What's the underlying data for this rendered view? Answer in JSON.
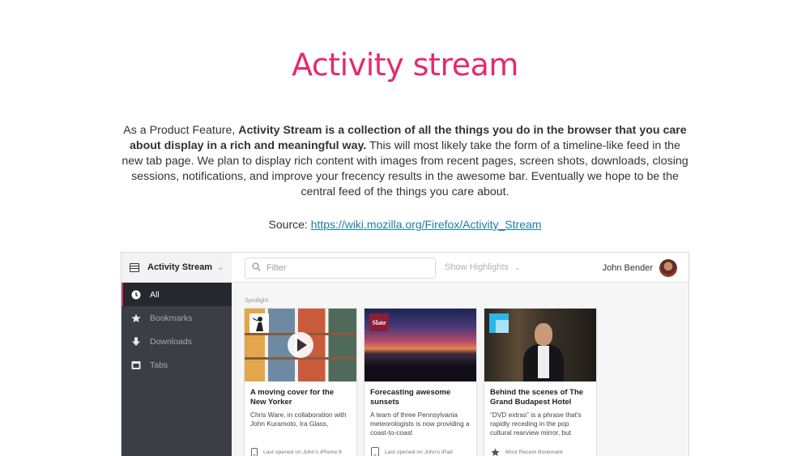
{
  "slide": {
    "title": "Activity stream",
    "desc_intro": "As a Product Feature, ",
    "desc_bold": "Activity Stream is a collection of all the things you do in the browser that you care about display in a rich and meaningful way.",
    "desc_rest": " This will most likely take the form of a timeline-like feed in the new tab page. We plan to display rich content with images from recent pages, screen shots, downloads, closing sessions, notifications, and improve your frecency results in the awesome bar. Eventually we hope to be the central feed of the things you care about.",
    "source_label": "Source: ",
    "source_link": "https://wiki.mozilla.org/Firefox/Activity_Stream"
  },
  "app": {
    "name": "Activity Stream",
    "sidebar": {
      "items": [
        {
          "label": "All",
          "icon": "clock-icon",
          "active": true
        },
        {
          "label": "Bookmarks",
          "icon": "star-icon",
          "active": false
        },
        {
          "label": "Downloads",
          "icon": "download-arrow-icon",
          "active": false
        },
        {
          "label": "Tabs",
          "icon": "tabs-icon",
          "active": false
        }
      ]
    },
    "topbar": {
      "filter_placeholder": "Filter",
      "show_label": "Show",
      "highlights_label": "Highlights",
      "user_name": "John Bender"
    },
    "spotlight_label": "Spotlight",
    "cards": [
      {
        "title": "A moving cover for the New Yorker",
        "description": "Chris Ware, in collaboration with John Kuramoto, Ira Glass,",
        "footer": "Last opened on John's iPhone 6",
        "footer_icon": "phone-icon"
      },
      {
        "title": "Forecasting awesome sunsets",
        "description": "A team of three Pennsylvania meteorologists is now providing a coast-to-coast",
        "footer": "Last opened on John's iPad",
        "footer_icon": "tablet-icon",
        "site_logo": "Slate"
      },
      {
        "title": "Behind the scenes of The Grand Budapest Hotel",
        "description": "“DVD extras” is a phrase that's rapidly receding in the pop cultural rearview mirror, but",
        "footer": "Most Recent Bookmark",
        "footer_icon": "star-icon"
      }
    ],
    "colors": {
      "accent": "#e6296e",
      "sidebar_bg": "#3b3e44",
      "link": "#1a7fa3"
    }
  }
}
